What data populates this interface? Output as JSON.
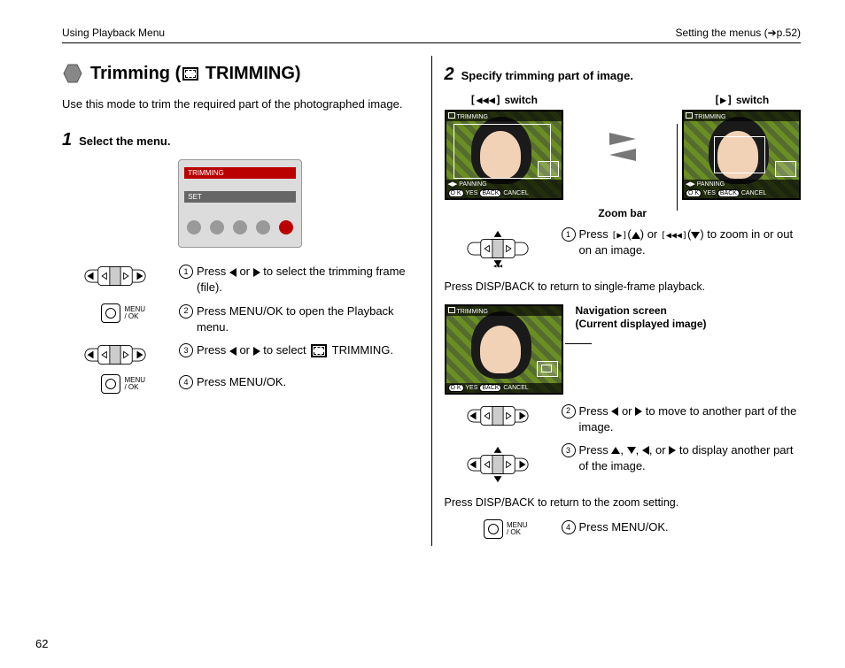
{
  "header": {
    "left": "Using Playback Menu",
    "right": "Setting the menus (➔p.52)"
  },
  "title": "Trimming ( TRIMMING)",
  "intro": "Use this mode to trim the required part of the photographed image.",
  "step1": {
    "heading": "Select the menu.",
    "num": "1",
    "menu": {
      "l1": "TRIMMING",
      "l2": "SET"
    },
    "s1": "Press  or  to select the trimming frame (file).",
    "s2": "Press MENU/OK to open the Playback menu.",
    "s3": "Press  or  to select  TRIMMING.",
    "s4": "Press MENU/OK.",
    "menuOkLabel": "MENU\n/ OK"
  },
  "step2": {
    "heading": "Specify trimming part of image.",
    "num": "2",
    "wideLabel": " switch",
    "teleLabel": " switch",
    "zoomBar": "Zoom bar",
    "lcd": {
      "hdr": "TRIMMING",
      "panning": "PANNING",
      "ftr_yes": "YES",
      "ftr_cancel": "CANCEL",
      "ok": "O K",
      "back": "BACK"
    },
    "s1": "Press (▲) or (▼) to zoom in or out on an image.",
    "note1": "Press DISP/BACK to return to single-frame playback.",
    "navCaption": "Navigation screen\n(Current displayed image)",
    "s2": "Press  or  to move to another part of the image.",
    "s3": "Press , , , or  to display another part of the image.",
    "note2": "Press DISP/BACK to return to the zoom setting.",
    "s4": "Press MENU/OK.",
    "menuOkLabel": "MENU\n/ OK"
  },
  "pageNumber": "62"
}
